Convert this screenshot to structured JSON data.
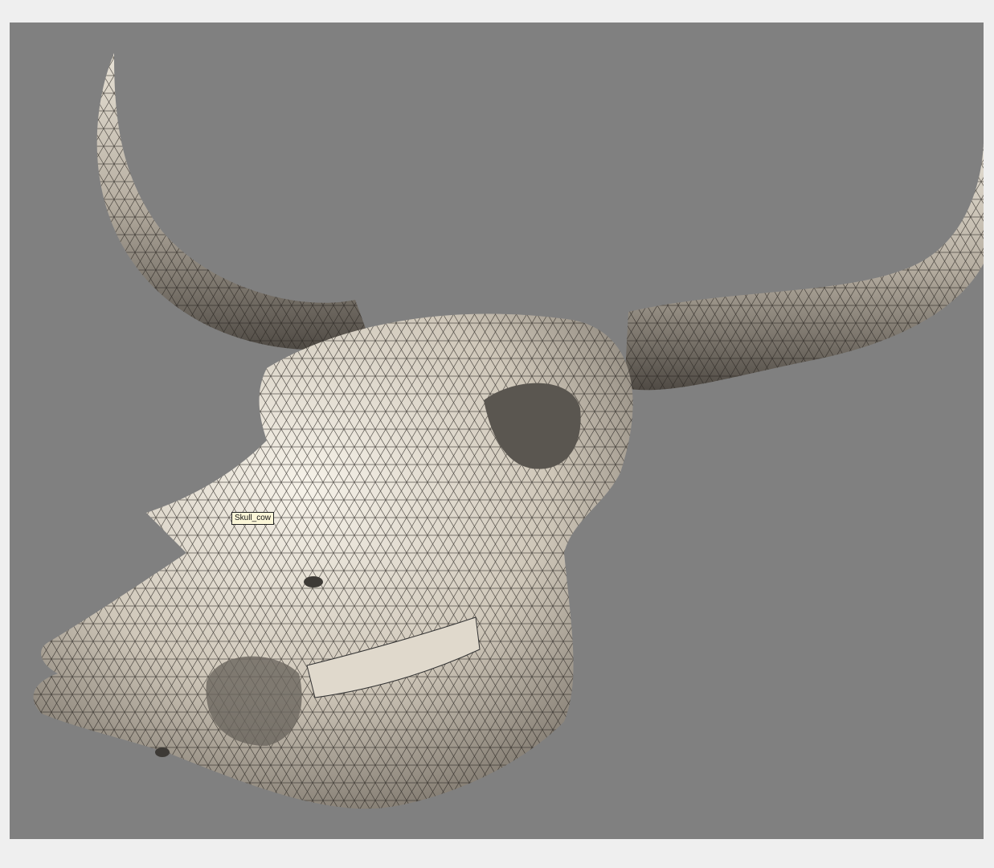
{
  "viewport": {
    "background_color": "#808080",
    "object_label": "Skull_cow",
    "model_color": "#d9d2c6"
  }
}
